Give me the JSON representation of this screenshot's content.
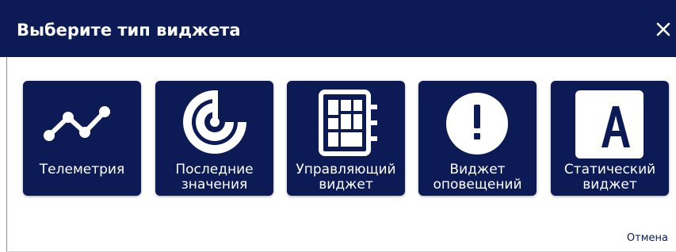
{
  "dialog": {
    "title": "Выберите тип виджета",
    "close_icon": "close-icon",
    "cancel_label": "Отмена"
  },
  "colors": {
    "header_bg": "#0c1b56",
    "tile_bg": "#0c1b56",
    "text_on_dark": "#ffffff"
  },
  "widgets": [
    {
      "icon": "line-chart-icon",
      "label_lines": [
        "Телеметрия"
      ]
    },
    {
      "icon": "radar-icon",
      "label_lines": [
        "Последние",
        "значения"
      ]
    },
    {
      "icon": "control-panel-icon",
      "label_lines": [
        "Управляющий",
        "виджет"
      ]
    },
    {
      "icon": "alert-icon",
      "label_lines": [
        "Виджет",
        "оповещений"
      ]
    },
    {
      "icon": "letter-a-icon",
      "label_lines": [
        "Статический",
        "виджет"
      ]
    }
  ]
}
